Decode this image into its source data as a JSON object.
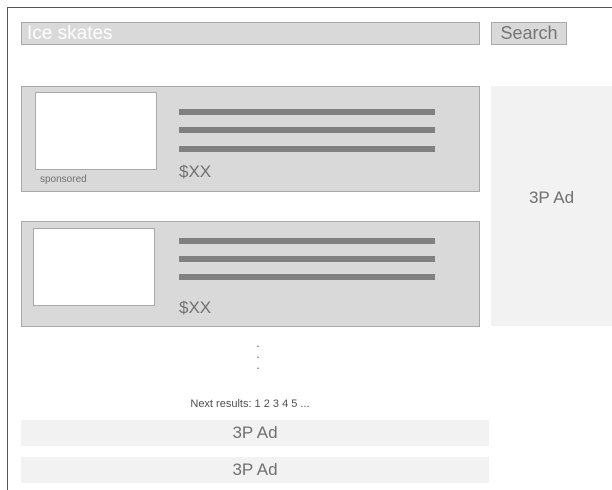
{
  "search": {
    "value": "Ice skates",
    "button_label": "Search"
  },
  "results": [
    {
      "sponsored_label": "sponsored",
      "price": "$XX"
    },
    {
      "sponsored_label": "",
      "price": "$XX"
    }
  ],
  "more_indicator": ":\n:",
  "pagination": {
    "text": "Next results: 1 2 3 4 5 ..."
  },
  "ads": {
    "side": "3P Ad",
    "bottom": [
      "3P Ad",
      "3P Ad"
    ]
  }
}
